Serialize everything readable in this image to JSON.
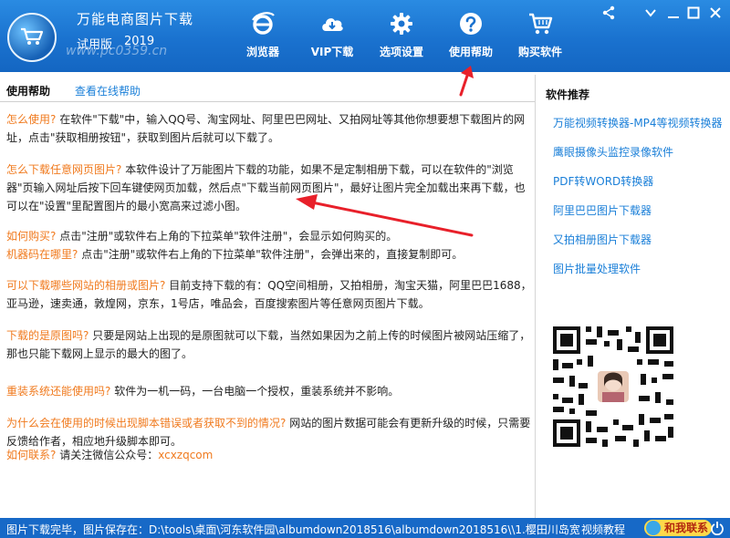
{
  "app": {
    "title": "万能电商图片下载",
    "edition": "试用版",
    "year": "2019",
    "watermark": "www.pc0359.cn"
  },
  "toolbar": [
    {
      "label": "浏览器",
      "icon": "ie-browser-icon"
    },
    {
      "label": "VIP下载",
      "icon": "cloud-download-icon"
    },
    {
      "label": "选项设置",
      "icon": "gear-icon"
    },
    {
      "label": "使用帮助",
      "icon": "help-icon"
    },
    {
      "label": "购买软件",
      "icon": "cart-icon"
    }
  ],
  "subheader": {
    "current_tab": "使用帮助",
    "online_help_link": "查看在线帮助"
  },
  "help": [
    {
      "q": "怎么使用?",
      "a": " 在软件\"下载\"中，输入QQ号、淘宝网址、阿里巴巴网址、又拍网址等其他你想要想下载图片的网址，点击\"获取相册按钮\"，获取到图片后就可以下载了。"
    },
    {
      "q": "怎么下载任意网页图片?",
      "a": " 本软件设计了万能图片下载的功能，如果不是定制相册下载，可以在软件的\"浏览器\"页输入网址后按下回车键使网页加载，然后点\"下载当前网页图片\"，最好让图片完全加载出来再下载，也可以在\"设置\"里配置图片的最小宽高来过滤小图。"
    },
    {
      "q": "如何购买?",
      "a": " 点击\"注册\"或软件右上角的下拉菜单\"软件注册\"，会显示如何购买的。"
    },
    {
      "q": "机器码在哪里?",
      "a": " 点击\"注册\"或软件右上角的下拉菜单\"软件注册\"，会弹出来的，直接复制即可。"
    },
    {
      "q": "可以下载哪些网站的相册或图片?",
      "a": " 目前支持下载的有：QQ空间相册，又拍相册，淘宝天猫，阿里巴巴1688，亚马逊，速卖通，敦煌网，京东，1号店，唯品会，百度搜索图片等任意网页图片下载。"
    },
    {
      "q": "下载的是原图吗?",
      "a": " 只要是网站上出现的是原图就可以下载，当然如果因为之前上传的时候图片被网站压缩了，那也只能下载网上显示的最大的图了。"
    },
    {
      "q": "重装系统还能使用吗?",
      "a": " 软件为一机一码，一台电脑一个授权，重装系统并不影响。"
    },
    {
      "q": "为什么会在使用的时候出现脚本错误或者获取不到的情况?",
      "a": " 网站的图片数据可能会有更新升级的时候，只需要反馈给作者，相应地升级脚本即可。"
    },
    {
      "q": "如何联系?",
      "a": " 请关注微信公众号：",
      "extra": "xcxzqcom"
    }
  ],
  "sidebar": {
    "title": "软件推荐",
    "items": [
      "万能视频转换器-MP4等视频转换器",
      "鹰眼摄像头监控录像软件",
      "PDF转WORD转换器",
      "阿里巴巴图片下载器",
      "又拍相册图片下载器",
      "图片批量处理软件"
    ]
  },
  "status": {
    "text": "图片下载完毕，图片保存在：D:\\tools\\桌面\\河东软件园\\albumdown2018516\\albumdown2018516\\\\1.樱田川岛宽松秋冬",
    "video_tutorial": "视频教程",
    "contact": "和我联系"
  },
  "colors": {
    "titlebar": "#1a72cf",
    "statusbar": "#1769c7",
    "question": "#f07a1e",
    "link": "#1a7fd8",
    "annotation": "#e8202a"
  }
}
